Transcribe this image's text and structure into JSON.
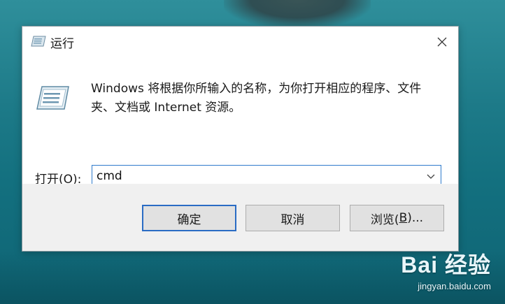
{
  "window": {
    "title": "运行",
    "close_symbol": "✕"
  },
  "body": {
    "description": "Windows 将根据你所输入的名称，为你打开相应的程序、文件夹、文档或 Internet 资源。"
  },
  "open_field": {
    "label_prefix": "打开(",
    "label_accel": "O",
    "label_suffix": "):",
    "value": "cmd"
  },
  "buttons": {
    "ok": "确定",
    "cancel": "取消",
    "browse_prefix": "浏览(",
    "browse_accel": "B",
    "browse_suffix": ")..."
  },
  "watermark": {
    "logo": "Bai 经验",
    "url": "jingyan.baidu.com"
  },
  "icons": {
    "title": "run-icon",
    "close": "close-icon",
    "dropdown": "chevron-down-icon"
  },
  "colors": {
    "accent": "#2a6cc4",
    "combo_border": "#2f7bcc",
    "footer_bg": "#f0f0f0"
  }
}
